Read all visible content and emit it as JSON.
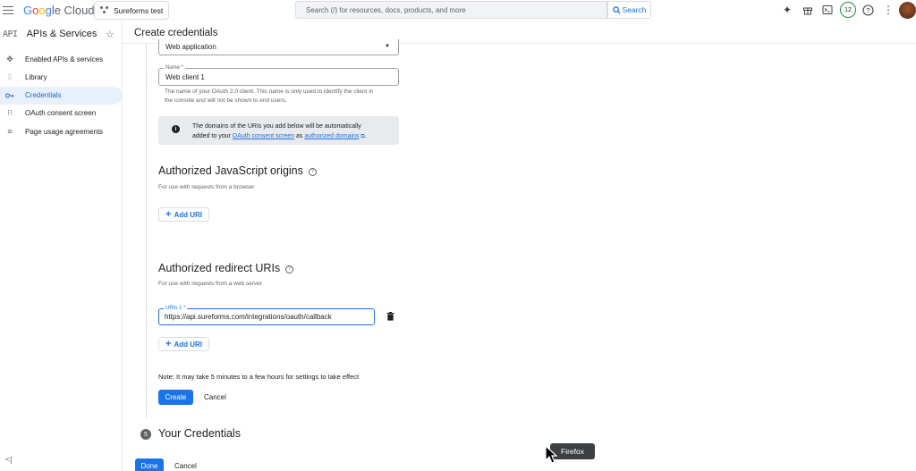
{
  "topbar": {
    "logo_parts": [
      "G",
      "o",
      "o",
      "g",
      "le Cloud"
    ],
    "project_name": "Sureforms test",
    "search_placeholder": "Search (/) for resources, docs, products, and more",
    "search_button_label": "Search",
    "notifications_count": "12"
  },
  "sidebar": {
    "api_badge": "API",
    "title": "APIs & Services",
    "items": [
      {
        "label": "Enabled APIs & services",
        "icon": "hub-icon"
      },
      {
        "label": "Library",
        "icon": "library-icon"
      },
      {
        "label": "Credentials",
        "icon": "key-icon",
        "active": true
      },
      {
        "label": "OAuth consent screen",
        "icon": "consent-icon"
      },
      {
        "label": "Page usage agreements",
        "icon": "settings-list-icon"
      }
    ],
    "collapse_glyph": "<|"
  },
  "page": {
    "title": "Create credentials"
  },
  "form": {
    "app_type_value": "Web application",
    "name_label": "Name *",
    "name_value": "Web client 1",
    "name_help_line1": "The name of your OAuth 2.0 client. This name is only used to identify the client in",
    "name_help_line2": "the console and will not be shown to end users.",
    "info_line1": "The domains of the URIs you add below will be automatically",
    "info_line2_prefix": "added to your ",
    "info_link1": "OAuth consent screen",
    "info_mid": " as ",
    "info_link2": "authorized domains",
    "info_suffix": ".",
    "js_origins_title": "Authorized JavaScript origins",
    "js_origins_sub": "For use with requests from a browser",
    "add_uri_label": "Add URI",
    "redirect_title": "Authorized redirect URIs",
    "redirect_sub": "For use with requests from a web server",
    "uri1_label": "URIs 1 *",
    "uri1_value": "https://api.sureforms.com/integrations/oauth/callback",
    "note": "Note: It may take 5 minutes to a few hours for settings to take effect",
    "create_label": "Create",
    "cancel_label": "Cancel"
  },
  "credentials_step": {
    "number": "5",
    "title": "Your Credentials",
    "done_label": "Done",
    "cancel_label": "Cancel"
  },
  "tooltip": {
    "text": "Firefox"
  },
  "colors": {
    "accent": "#1a73e8",
    "active_bg": "#e8f0fe",
    "info_bg": "#e8eaed"
  }
}
